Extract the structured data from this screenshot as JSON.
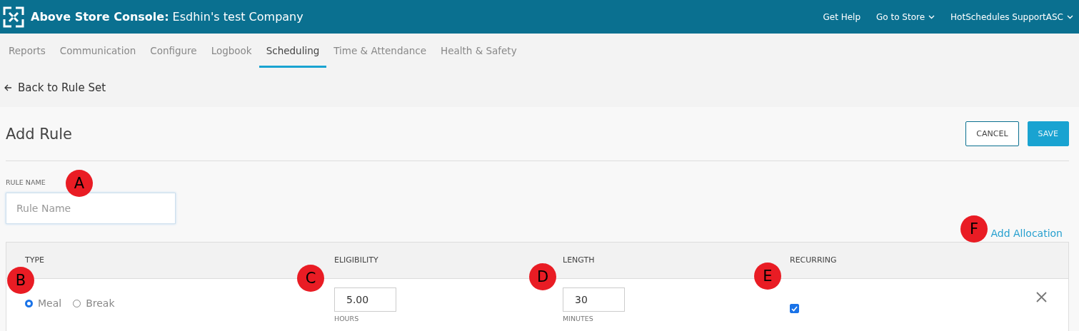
{
  "header": {
    "brand": "Above Store Console:",
    "company": "Esdhin's test Company",
    "links": [
      {
        "label": "Get Help",
        "dropdown": false
      },
      {
        "label": "Go to Store",
        "dropdown": true
      },
      {
        "label": "HotSchedules SupportASC",
        "dropdown": true
      }
    ]
  },
  "tabs": [
    {
      "label": "Reports",
      "selected": false
    },
    {
      "label": "Communication",
      "selected": false
    },
    {
      "label": "Configure",
      "selected": false
    },
    {
      "label": "Logbook",
      "selected": false
    },
    {
      "label": "Scheduling",
      "selected": true
    },
    {
      "label": "Time & Attendance",
      "selected": false
    },
    {
      "label": "Health & Safety",
      "selected": false
    }
  ],
  "back_link": "Back to Rule Set",
  "page_title": "Add Rule",
  "buttons": [
    {
      "label": "CANCEL",
      "kind": "outline"
    },
    {
      "label": "SAVE",
      "kind": "primary"
    }
  ],
  "rule_name": {
    "label": "RULE NAME",
    "placeholder": "Rule Name"
  },
  "add_allocation": "Add Allocation",
  "table": {
    "columns": [
      "TYPE",
      "ELIGIBILITY",
      "LENGTH",
      "RECURRING"
    ],
    "rows": [
      {
        "types": [
          {
            "label": "Meal",
            "selected": true
          },
          {
            "label": "Break",
            "selected": false
          }
        ],
        "eligibility": "5.00",
        "eligibility_unit": "HOURS",
        "length": "30",
        "length_unit": "MINUTES",
        "recurring": true
      }
    ]
  },
  "callouts": [
    "A",
    "B",
    "C",
    "D",
    "E",
    "F"
  ]
}
